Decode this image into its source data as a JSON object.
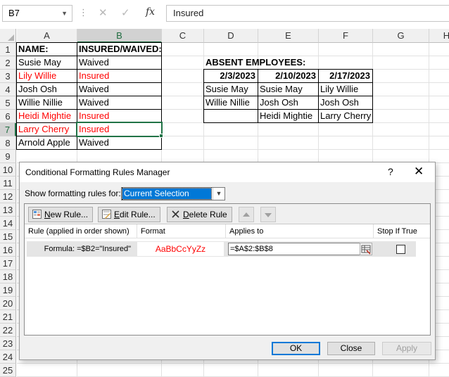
{
  "formula_bar": {
    "name_box": "B7",
    "fx_label": "fx",
    "cancel_icon": "cross-icon",
    "enter_icon": "check-icon",
    "formula": "Insured"
  },
  "columns": [
    "A",
    "B",
    "C",
    "D",
    "E",
    "F",
    "G",
    "H"
  ],
  "rows": [
    "1",
    "2",
    "3",
    "4",
    "5",
    "6",
    "7",
    "8",
    "9",
    "10",
    "11",
    "12",
    "13",
    "14",
    "15",
    "16",
    "17",
    "18",
    "19",
    "20",
    "21",
    "22",
    "23",
    "24",
    "25"
  ],
  "sheet": {
    "name_header": "NAME:",
    "status_header": "INSURED/WAIVED:",
    "employees": [
      {
        "name": "Susie May",
        "status": "Waived",
        "highlight": false
      },
      {
        "name": "Lily Willie",
        "status": "Insured",
        "highlight": true
      },
      {
        "name": "Josh Osh",
        "status": "Waived",
        "highlight": false
      },
      {
        "name": "Willie Nillie",
        "status": "Waived",
        "highlight": false
      },
      {
        "name": "Heidi Mightie",
        "status": "Insured",
        "highlight": true
      },
      {
        "name": "Larry Cherry",
        "status": "Insured",
        "highlight": true
      },
      {
        "name": "Arnold Apple",
        "status": "Waived",
        "highlight": false
      }
    ],
    "absent_title": "ABSENT EMPLOYEES:",
    "absent_dates": [
      "2/3/2023",
      "2/10/2023",
      "2/17/2023"
    ],
    "absent_rows": [
      [
        "Susie May",
        "Susie May",
        "Lily Willie"
      ],
      [
        "Willie Nillie",
        "Josh Osh",
        "Josh Osh"
      ],
      [
        "",
        "Heidi Mightie",
        "Larry Cherry"
      ]
    ],
    "highlight_color": "#ff0000",
    "selection_color": "#217346"
  },
  "dialog": {
    "title": "Conditional Formatting Rules Manager",
    "help": "?",
    "close": "✕",
    "show_label": "Show formatting rules for:",
    "show_value": "Current Selection",
    "toolbar": {
      "new_rule": {
        "underlined": "N",
        "rest": "ew Rule..."
      },
      "edit_rule": {
        "underlined": "E",
        "rest": "dit Rule..."
      },
      "delete_rule": {
        "underlined": "D",
        "rest": "elete Rule"
      }
    },
    "headers": {
      "rule": "Rule (applied in order shown)",
      "format": "Format",
      "applies": "Applies to",
      "stop": "Stop If True"
    },
    "rule": {
      "description": "Formula: =$B2=\"Insured\"",
      "format_preview": "AaBbCcYyZz",
      "applies_to": "=$A$2:$B$8",
      "stop_if_true": false
    },
    "buttons": {
      "ok": "OK",
      "close": "Close",
      "apply": "Apply"
    }
  }
}
